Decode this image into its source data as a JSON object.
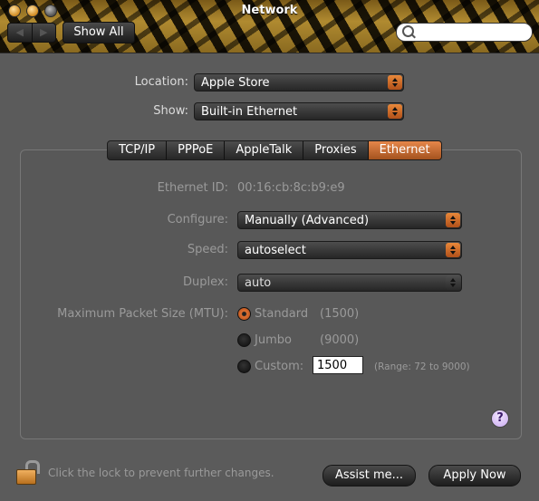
{
  "window": {
    "title": "Network"
  },
  "toolbar": {
    "show_all_label": "Show All",
    "search_value": ""
  },
  "location": {
    "label": "Location:",
    "value": "Apple Store"
  },
  "show": {
    "label": "Show:",
    "value": "Built-in Ethernet"
  },
  "tabs": [
    {
      "label": "TCP/IP",
      "active": false
    },
    {
      "label": "PPPoE",
      "active": false
    },
    {
      "label": "AppleTalk",
      "active": false
    },
    {
      "label": "Proxies",
      "active": false
    },
    {
      "label": "Ethernet",
      "active": true
    }
  ],
  "ethernet": {
    "id_label": "Ethernet ID:",
    "id_value": "00:16:cb:8c:b9:e9",
    "configure_label": "Configure:",
    "configure_value": "Manually (Advanced)",
    "speed_label": "Speed:",
    "speed_value": "autoselect",
    "duplex_label": "Duplex:",
    "duplex_value": "auto",
    "mtu_label": "Maximum Packet Size (MTU):",
    "mtu_options": [
      {
        "label": "Standard",
        "value": "(1500)",
        "selected": true
      },
      {
        "label": "Jumbo",
        "value": "(9000)",
        "selected": false
      },
      {
        "label": "Custom:",
        "value": "1500",
        "selected": false
      }
    ],
    "range_text": "(Range: 72 to 9000)"
  },
  "footer": {
    "lock_text": "Click the lock to prevent further changes.",
    "assist_label": "Assist me...",
    "apply_label": "Apply Now"
  },
  "colors": {
    "accent": "#d8703a",
    "background": "#5b5b5b"
  }
}
